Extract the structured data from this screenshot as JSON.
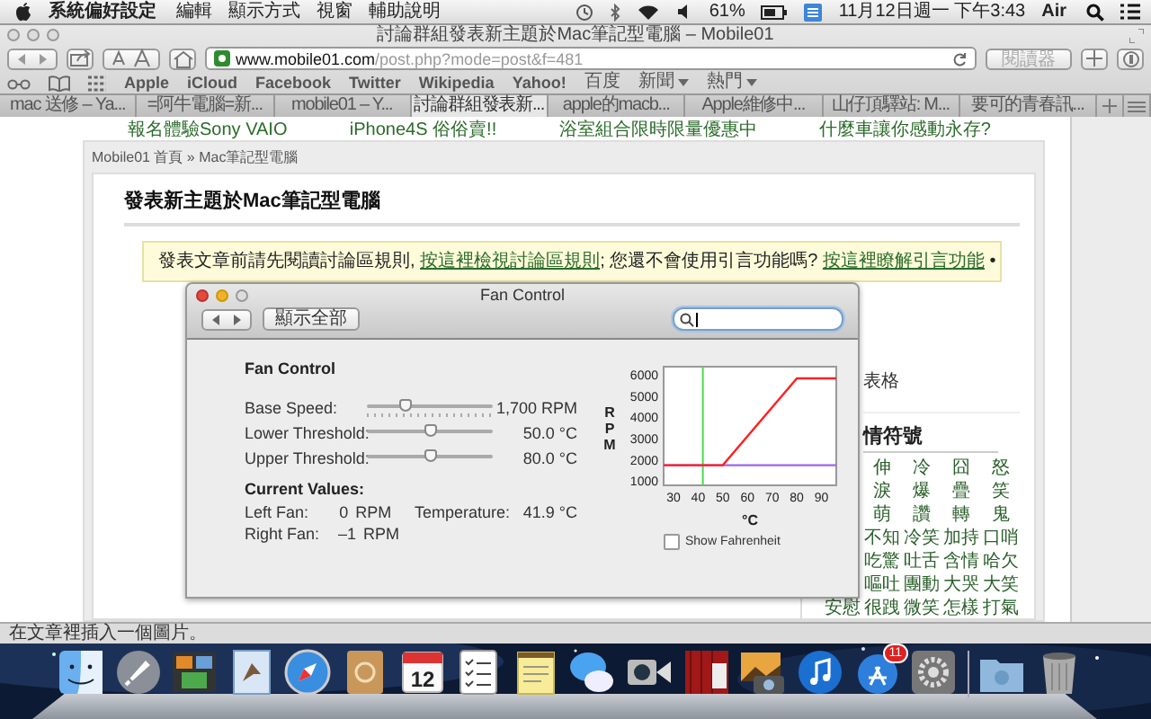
{
  "menu_bar": {
    "app": "系統偏好設定",
    "items": [
      "編輯",
      "顯示方式",
      "視窗",
      "輔助說明"
    ],
    "battery": "61%",
    "clock": "11月12日週一 下午3:43",
    "user": "Air"
  },
  "browser": {
    "title": "討論群組發表新主題於Mac筆記型電腦 – Mobile01",
    "url_host": "www.mobile01.com",
    "url_path": "/post.php?mode=post&f=481",
    "reader": "閱讀器",
    "bookmarks": [
      {
        "label": "Apple",
        "menu": false
      },
      {
        "label": "iCloud",
        "menu": false
      },
      {
        "label": "Facebook",
        "menu": false
      },
      {
        "label": "Twitter",
        "menu": false
      },
      {
        "label": "Wikipedia",
        "menu": false
      },
      {
        "label": "Yahoo!",
        "menu": false
      },
      {
        "label": "百度",
        "menu": false
      },
      {
        "label": "新聞",
        "menu": true
      },
      {
        "label": "熱門",
        "menu": true
      }
    ],
    "tabs": [
      {
        "label": "mac 送修 – Ya...",
        "selected": false
      },
      {
        "label": "=阿牛電腦=新...",
        "selected": false
      },
      {
        "label": "mobile01 – Y...",
        "selected": false
      },
      {
        "label": "討論群組發表新...",
        "selected": true
      },
      {
        "label": "apple的macb...",
        "selected": false
      },
      {
        "label": "Apple維修中...",
        "selected": false
      },
      {
        "label": "山仔頂驛站: M...",
        "selected": false
      },
      {
        "label": "要可的青春訊...",
        "selected": false
      }
    ]
  },
  "page": {
    "ads": [
      "報名體驗Sony VAIO",
      "iPhone4S 俗俗賣!!",
      "浴室組合限時限量優惠中",
      "什麼車讓你感動永存?"
    ],
    "breadcrumb": "Mobile01 首頁 » Mac筆記型電腦",
    "heading": "發表新主題於Mac筆記型電腦",
    "notice": [
      {
        "text": "發表文章前請先閱讀討論區規則, ",
        "link": false
      },
      {
        "text": "按這裡檢視討論區規則",
        "link": true
      },
      {
        "text": "; 您還不會使用引言功能嗎? ",
        "link": false
      },
      {
        "text": "按這裡瞭解引言功能",
        "link": true
      },
      {
        "text": " •",
        "link": false
      }
    ],
    "side_label": "表格",
    "emoticons_title": "情符號",
    "emoticons": [
      [
        "伸",
        "冷",
        "囧",
        "怒"
      ],
      [
        "淚",
        "爆",
        "疊",
        "笑"
      ],
      [
        "萌",
        "讚",
        "轉",
        "鬼"
      ],
      [
        "不知",
        "冷笑",
        "加持",
        "口哨"
      ],
      [
        "吃驚",
        "吐舌",
        "含情",
        "哈欠"
      ],
      [
        "嘔吐",
        "團動",
        "大哭",
        "大笑"
      ],
      [
        "很跩",
        "微笑",
        "怎樣",
        "打氣"
      ]
    ],
    "emoticons_extra": "安慰",
    "status": "在文章裡插入一個圖片。"
  },
  "fan_window": {
    "title": "Fan Control",
    "show_all": "顯示全部",
    "section": "Fan Control",
    "sliders": [
      {
        "label": "Base Speed:",
        "level": 0.3,
        "reading": "1,700 RPM"
      },
      {
        "label": "Lower Threshold:",
        "level": 0.5,
        "reading": "50.0 °C"
      },
      {
        "label": "Upper Threshold:",
        "level": 0.5,
        "reading": "80.0 °C"
      }
    ],
    "current_title": "Current Values:",
    "fans": [
      {
        "label": "Left Fan:",
        "value": "0",
        "unit": "RPM"
      },
      {
        "label": "Right Fan:",
        "value": "–1",
        "unit": "RPM"
      }
    ],
    "temperature": {
      "label": "Temperature:",
      "value": "41.9 °C"
    },
    "chart_data": {
      "type": "line",
      "xlabel": "°C",
      "ylabel": "RPM",
      "x": [
        26,
        50,
        80,
        96
      ],
      "series": [
        {
          "color": "#ff2020",
          "values": [
            1700,
            1700,
            5800,
            5800
          ]
        },
        {
          "color": "#9966ee",
          "values": [
            1700,
            1700,
            1700,
            1700
          ]
        }
      ],
      "xlim": [
        26,
        96
      ],
      "ylim": [
        750,
        6350
      ],
      "xticks": [
        30,
        40,
        50,
        60,
        70,
        80,
        90
      ],
      "yticks": [
        1000,
        2000,
        3000,
        4000,
        5000,
        6000
      ],
      "ref_lines": [
        {
          "axis": "x",
          "value": 41.9,
          "color": "#44dd44"
        }
      ]
    },
    "fahrenheit": {
      "label": "Show Fahrenheit",
      "checked": false
    }
  },
  "dock": [
    {
      "kind": "finder"
    },
    {
      "kind": "launchpad"
    },
    {
      "kind": "mission"
    },
    {
      "kind": "mail"
    },
    {
      "kind": "safari"
    },
    {
      "kind": "contacts"
    },
    {
      "kind": "calendar",
      "text": "12"
    },
    {
      "kind": "reminders"
    },
    {
      "kind": "notes"
    },
    {
      "kind": "messages"
    },
    {
      "kind": "facetime"
    },
    {
      "kind": "photobooth"
    },
    {
      "kind": "iphoto"
    },
    {
      "kind": "itunes"
    },
    {
      "kind": "appstore",
      "badge": "11"
    },
    {
      "kind": "prefs"
    },
    {
      "kind": "separator"
    },
    {
      "kind": "downloads"
    },
    {
      "kind": "trash"
    }
  ]
}
